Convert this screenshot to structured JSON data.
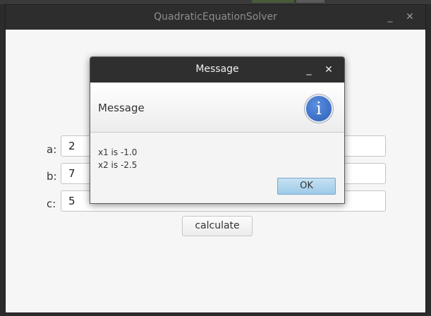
{
  "main_window": {
    "title": "QuadraticEquationSolver",
    "minimize_glyph": "_",
    "close_glyph": "✕",
    "fields": [
      {
        "label": "a:",
        "value": "2"
      },
      {
        "label": "b:",
        "value": "7"
      },
      {
        "label": "c:",
        "value": "5"
      }
    ],
    "calculate_label": "calculate"
  },
  "dialog": {
    "title": "Message",
    "minimize_glyph": "_",
    "close_glyph": "✕",
    "header_text": "Message",
    "icon": "info-icon",
    "icon_glyph": "i",
    "body_lines": [
      "x1 is -1.0",
      "x2 is -2.5"
    ],
    "ok_label": "OK"
  },
  "colors": {
    "titlebar": "#2d2d2d",
    "window_bg": "#f6f6f6",
    "ok_button": "#aed4ee",
    "info_icon": "#3a6fc9"
  }
}
